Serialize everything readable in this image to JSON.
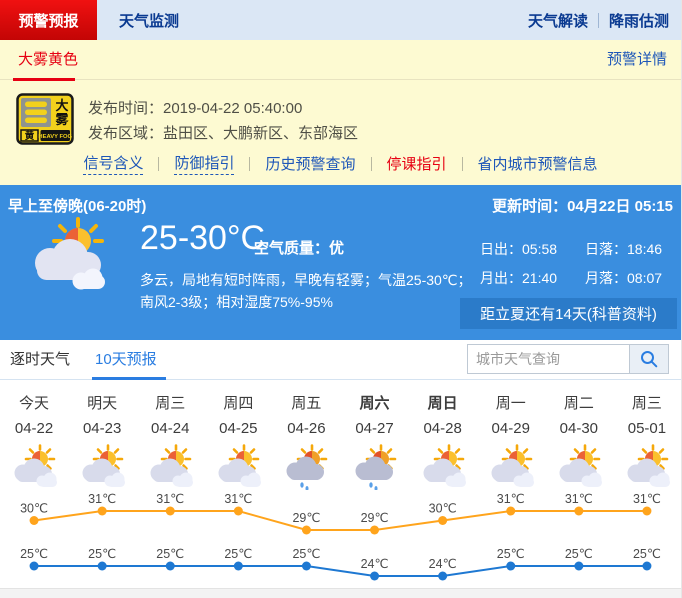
{
  "colors": {
    "alert_red": "#e60012",
    "nav_navy": "#0a3a91",
    "link_blue": "#1d56b8",
    "panel_blue": "#3a8edf",
    "badge_blue": "#2b7bc9",
    "tab_blue": "#2a7de1",
    "high_line_orange": "#FFA41C",
    "low_line_blue": "#1E78D2",
    "alert_bg_yellow": "#fdfad2"
  },
  "top_nav": {
    "tabs": [
      {
        "label": "预警预报",
        "active": true
      },
      {
        "label": "天气监测",
        "active": false
      }
    ],
    "links": [
      {
        "label": "天气解读"
      },
      {
        "label": "降雨估测"
      }
    ]
  },
  "alert_section": {
    "tab": "大雾黄色",
    "detail_link": "预警详情",
    "icon": {
      "name": "heavy-fog-yellow-warning",
      "side_text": "大雾",
      "level_text": "黄",
      "footer_text": "HEAVY FOG"
    },
    "publish_time": "发布时间：2019-04-22 05:40:00",
    "publish_area": "发布区域：盐田区、大鹏新区、东部海区",
    "links": [
      {
        "label": "信号含义",
        "style": "dotted"
      },
      {
        "label": "防御指引",
        "style": "dotted"
      },
      {
        "label": "历史预警查询",
        "style": "plain"
      },
      {
        "label": "停课指引",
        "style": "red"
      },
      {
        "label": "省内城市预警信息",
        "style": "plain"
      }
    ]
  },
  "current_weather": {
    "period": "早上至傍晚(06-20时)",
    "update_time": "更新时间：04月22日 05:15",
    "temp_range": "25-30°C",
    "air_quality": "空气质量：优",
    "description_line1": "多云，局地有短时阵雨，早晚有轻雾；气温25-30℃；",
    "description_line2": "南风2-3级；相对湿度75%-95%",
    "sunrise": "日出：05:58",
    "sunset": "日落：18:46",
    "moonrise": "月出：21:40",
    "moonset": "月落：08:07",
    "badge": "距立夏还有14天(科普资料)"
  },
  "forecast": {
    "tabs": [
      {
        "label": "逐时天气",
        "active": false
      },
      {
        "label": "10天预报",
        "active": true
      }
    ],
    "search": {
      "placeholder": "城市天气查询",
      "icon": "search-icon"
    },
    "chart_data": {
      "type": "line",
      "unit": "℃",
      "days": [
        {
          "label": "今天",
          "date": "04-22",
          "icon": "cloudy",
          "bold": false
        },
        {
          "label": "明天",
          "date": "04-23",
          "icon": "cloudy",
          "bold": false
        },
        {
          "label": "周三",
          "date": "04-24",
          "icon": "cloudy",
          "bold": false
        },
        {
          "label": "周四",
          "date": "04-25",
          "icon": "cloudy",
          "bold": false
        },
        {
          "label": "周五",
          "date": "04-26",
          "icon": "rain",
          "bold": false
        },
        {
          "label": "周六",
          "date": "04-27",
          "icon": "rain",
          "bold": true
        },
        {
          "label": "周日",
          "date": "04-28",
          "icon": "cloudy",
          "bold": true
        },
        {
          "label": "周一",
          "date": "04-29",
          "icon": "cloudy",
          "bold": false
        },
        {
          "label": "周二",
          "date": "04-30",
          "icon": "cloudy",
          "bold": false
        },
        {
          "label": "周三",
          "date": "05-01",
          "icon": "cloudy",
          "bold": false
        }
      ],
      "series": [
        {
          "name": "high",
          "color": "#FFA41C",
          "values": [
            30,
            31,
            31,
            31,
            29,
            29,
            30,
            31,
            31,
            31
          ]
        },
        {
          "name": "low",
          "color": "#1E78D2",
          "values": [
            25,
            25,
            25,
            25,
            25,
            24,
            24,
            25,
            25,
            25
          ]
        }
      ],
      "legend_position": "none",
      "grid": false
    }
  }
}
